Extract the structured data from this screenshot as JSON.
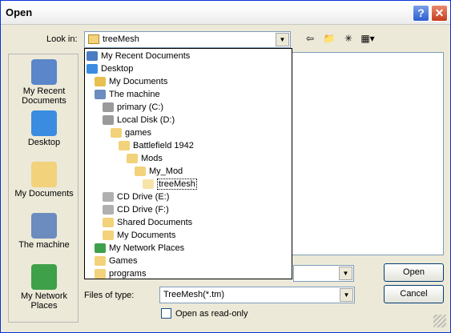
{
  "window": {
    "title": "Open"
  },
  "lookin": {
    "label": "Look in:",
    "value": "treeMesh"
  },
  "dropdown_items": [
    {
      "label": "My Recent Documents",
      "indent": 0,
      "color": "#4a7cc4"
    },
    {
      "label": "Desktop",
      "indent": 0,
      "color": "#3a8ce0"
    },
    {
      "label": "My Documents",
      "indent": 1,
      "color": "#e8c050"
    },
    {
      "label": "The machine",
      "indent": 1,
      "color": "#6c8bbf"
    },
    {
      "label": "primary (C:)",
      "indent": 2,
      "color": "#9a9a9a"
    },
    {
      "label": "Local Disk (D:)",
      "indent": 2,
      "color": "#9a9a9a"
    },
    {
      "label": "games",
      "indent": 3,
      "color": "#f2d27a"
    },
    {
      "label": "Battlefield 1942",
      "indent": 4,
      "color": "#f2d27a"
    },
    {
      "label": "Mods",
      "indent": 5,
      "color": "#f2d27a"
    },
    {
      "label": "My_Mod",
      "indent": 6,
      "color": "#f2d27a"
    },
    {
      "label": "treeMesh",
      "indent": 7,
      "color": "#f7e4a8"
    },
    {
      "label": "CD Drive (E:)",
      "indent": 2,
      "color": "#b0b0b0"
    },
    {
      "label": "CD Drive (F:)",
      "indent": 2,
      "color": "#b0b0b0"
    },
    {
      "label": "Shared Documents",
      "indent": 2,
      "color": "#f2d27a"
    },
    {
      "label": "My Documents",
      "indent": 2,
      "color": "#f2d27a"
    },
    {
      "label": "My Network Places",
      "indent": 1,
      "color": "#3fa04a"
    },
    {
      "label": "Games",
      "indent": 1,
      "color": "#f2d27a"
    },
    {
      "label": "programs",
      "indent": 1,
      "color": "#f2d27a"
    }
  ],
  "places": [
    {
      "label": "My Recent\nDocuments"
    },
    {
      "label": "Desktop"
    },
    {
      "label": "My Documents"
    },
    {
      "label": "The machine"
    },
    {
      "label": "My Network\nPlaces"
    }
  ],
  "filetype": {
    "label": "Files of type:",
    "value": "TreeMesh(*.tm)"
  },
  "readonly": {
    "label": "Open as read-only"
  },
  "buttons": {
    "open": "Open",
    "cancel": "Cancel"
  }
}
